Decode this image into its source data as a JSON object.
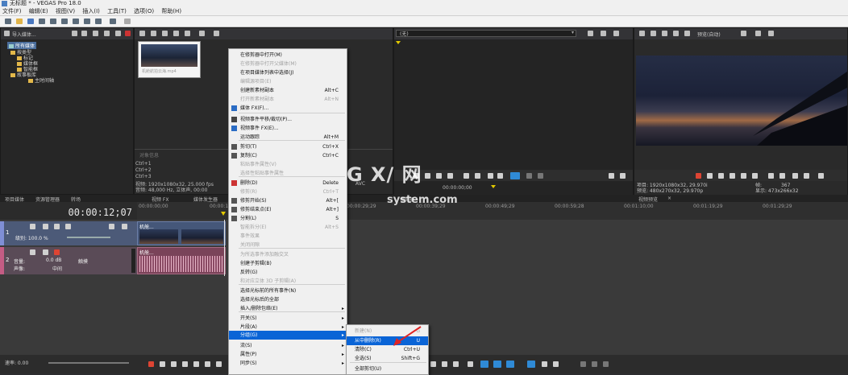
{
  "title": "无标题 * - VEGAS Pro 18.0",
  "menu": [
    "文件(F)",
    "编辑(E)",
    "视图(V)",
    "插入(I)",
    "工具(T)",
    "选项(O)",
    "帮助(H)"
  ],
  "explorer": {
    "toolbar_label": "导入媒体...",
    "tree": [
      {
        "label": "所有媒体",
        "selected": true
      },
      {
        "label": "按类型",
        "selected": false
      },
      {
        "label": "标记",
        "selected": false
      },
      {
        "label": "媒体框",
        "selected": false
      },
      {
        "label": "智能框",
        "selected": false
      },
      {
        "label": "故事板库",
        "selected": false
      },
      {
        "label": "主时间轴",
        "selected": false
      }
    ],
    "thumb_caption": "机舱航拍云海.mp4",
    "tabs": [
      "项目媒体",
      "资源管理器",
      "转场",
      "视频 FX",
      "媒体发生器"
    ],
    "info_header": "对象信息",
    "shortcuts": [
      "Ctrl+1",
      "Ctrl+2",
      "Ctrl+3"
    ],
    "info_lines": [
      "视频: 1920x1080x32, 25.000 fps",
      "音频: 48,000 Hz, 立体声, 00:00"
    ]
  },
  "trimmer": {
    "dropdown": "(无)",
    "timecode": "00:00:00;00",
    "tab": "修剪器",
    "side_label": "AVC"
  },
  "preview": {
    "quality": "预览(自动)",
    "project_line": "项目: 1920x1080x32, 29.970i",
    "preview_line": "预览: 480x270x32, 29.970p",
    "frame_label": "帧:",
    "frame_value": "367",
    "display_line": "显示: 473x266x32",
    "tab": "视频预览"
  },
  "timeline": {
    "timecode": "00:00:12;07",
    "video_track": {
      "number": "1",
      "level": "级别: 100.0 %"
    },
    "audio_track": {
      "number": "2",
      "volume_label": "音量:",
      "volume_value": "0.0 dB",
      "pan_label": "声像:",
      "pan_value": "中间",
      "mode": "触摸"
    },
    "clip_label": "机舱...",
    "ruler": [
      "00:00:00;00",
      "00:00:10;00",
      "00:00:19;29",
      "00:00:29;29",
      "00:00:39;29",
      "00:00:49;29",
      "00:00:59;28",
      "00:01:10;00",
      "00:01:19;29",
      "00:01:29;29"
    ],
    "rate": "速率: 0.00"
  },
  "context_menu": [
    {
      "label": "在修剪器中打开(M)",
      "shortcut": "",
      "disabled": false,
      "arrow": false,
      "icon": ""
    },
    {
      "label": "在修剪器中打开父媒体(M)",
      "shortcut": "",
      "disabled": true,
      "arrow": false,
      "icon": ""
    },
    {
      "label": "在项目媒体列表中选择(J)",
      "shortcut": "",
      "disabled": false,
      "arrow": false,
      "icon": ""
    },
    {
      "label": "编辑源项目(E)",
      "shortcut": "",
      "disabled": true,
      "arrow": false,
      "icon": ""
    },
    {
      "label": "创建新素材副本",
      "shortcut": "Alt+C",
      "disabled": false,
      "arrow": false,
      "icon": ""
    },
    {
      "label": "打开新素材副本",
      "shortcut": "Alt+N",
      "disabled": true,
      "arrow": false,
      "icon": ""
    },
    {
      "label": "媒体 FX(F)...",
      "shortcut": "",
      "disabled": false,
      "arrow": false,
      "icon": "#2b6cc4"
    },
    {
      "label": "视频事件平移/裁切(P)...",
      "shortcut": "",
      "disabled": false,
      "arrow": false,
      "icon": "#444"
    },
    {
      "label": "视频事件 FX(E)...",
      "shortcut": "",
      "disabled": false,
      "arrow": false,
      "icon": "#2b6cc4"
    },
    {
      "label": "运动跟踪",
      "shortcut": "Alt+M",
      "disabled": false,
      "arrow": false,
      "icon": ""
    },
    {
      "label": "剪切(T)",
      "shortcut": "Ctrl+X",
      "disabled": false,
      "arrow": false,
      "icon": "#555"
    },
    {
      "label": "复制(C)",
      "shortcut": "Ctrl+C",
      "disabled": false,
      "arrow": false,
      "icon": "#555"
    },
    {
      "label": "粘贴事件属性(V)",
      "shortcut": "",
      "disabled": true,
      "arrow": false,
      "icon": ""
    },
    {
      "label": "选择性粘贴事件属性",
      "shortcut": "",
      "disabled": true,
      "arrow": false,
      "icon": ""
    },
    {
      "label": "删除(D)",
      "shortcut": "Delete",
      "disabled": false,
      "arrow": false,
      "icon": "#c33"
    },
    {
      "label": "修剪(R)",
      "shortcut": "Ctrl+T",
      "disabled": true,
      "arrow": false,
      "icon": ""
    },
    {
      "label": "修剪开始(S)",
      "shortcut": "Alt+[",
      "disabled": false,
      "arrow": false,
      "icon": "#555"
    },
    {
      "label": "修剪结束点(E)",
      "shortcut": "Alt+]",
      "disabled": false,
      "arrow": false,
      "icon": "#555"
    },
    {
      "label": "分割(L)",
      "shortcut": "S",
      "disabled": false,
      "arrow": false,
      "icon": "#555"
    },
    {
      "label": "智能拆分(E)",
      "shortcut": "Alt+S",
      "disabled": true,
      "arrow": false,
      "icon": ""
    },
    {
      "label": "事件效果",
      "shortcut": "",
      "disabled": true,
      "arrow": false,
      "icon": ""
    },
    {
      "label": "关闭间隙",
      "shortcut": "",
      "disabled": true,
      "arrow": false,
      "icon": ""
    },
    {
      "label": "为所选事件添加融交叉",
      "shortcut": "",
      "disabled": true,
      "arrow": false,
      "icon": ""
    },
    {
      "label": "创建子剪辑(B)",
      "shortcut": "",
      "disabled": false,
      "arrow": false,
      "icon": ""
    },
    {
      "label": "反转(G)",
      "shortcut": "",
      "disabled": false,
      "arrow": false,
      "icon": ""
    },
    {
      "label": "和对应立体 3D 子剪辑(A)",
      "shortcut": "",
      "disabled": true,
      "arrow": false,
      "icon": ""
    },
    {
      "label": "选择光标前的所有事件(N)",
      "shortcut": "",
      "disabled": false,
      "arrow": false,
      "icon": ""
    },
    {
      "label": "选择光标后的全部",
      "shortcut": "",
      "disabled": false,
      "arrow": false,
      "icon": ""
    },
    {
      "label": "插入/删除包络(E)",
      "shortcut": "",
      "disabled": false,
      "arrow": true,
      "icon": ""
    },
    {
      "label": "开关(S)",
      "shortcut": "",
      "disabled": false,
      "arrow": true,
      "icon": ""
    },
    {
      "label": "片段(A)",
      "shortcut": "",
      "disabled": false,
      "arrow": true,
      "icon": ""
    },
    {
      "label": "分组(G)",
      "shortcut": "",
      "disabled": false,
      "arrow": true,
      "icon": "",
      "selected": true
    },
    {
      "label": "流(S)",
      "shortcut": "",
      "disabled": false,
      "arrow": true,
      "icon": ""
    },
    {
      "label": "属性(P)",
      "shortcut": "",
      "disabled": false,
      "arrow": true,
      "icon": ""
    },
    {
      "label": "同步(S)",
      "shortcut": "",
      "disabled": false,
      "arrow": true,
      "icon": ""
    },
    {
      "label": "创建与选定事件的同步链接(L)",
      "shortcut": "",
      "disabled": true,
      "arrow": false,
      "icon": ""
    },
    {
      "label": "同步链接(L)",
      "shortcut": "",
      "disabled": false,
      "arrow": true,
      "icon": ""
    },
    {
      "label": "属性...",
      "shortcut": "",
      "disabled": false,
      "arrow": false,
      "icon": ""
    }
  ],
  "submenu": [
    {
      "label": "新建(N)",
      "shortcut": "G",
      "disabled": true,
      "selected": false
    },
    {
      "label": "从中删除(R)",
      "shortcut": "U",
      "disabled": false,
      "selected": true
    },
    {
      "label": "清除(C)",
      "shortcut": "Ctrl+U",
      "disabled": false,
      "selected": false
    },
    {
      "label": "全选(S)",
      "shortcut": "Shift+G",
      "disabled": false,
      "selected": false
    },
    {
      "label": "全部剪切(U)",
      "shortcut": "",
      "disabled": false,
      "selected": false
    }
  ],
  "watermark": {
    "logo": "G X/ 网",
    "domain": "system.com"
  }
}
